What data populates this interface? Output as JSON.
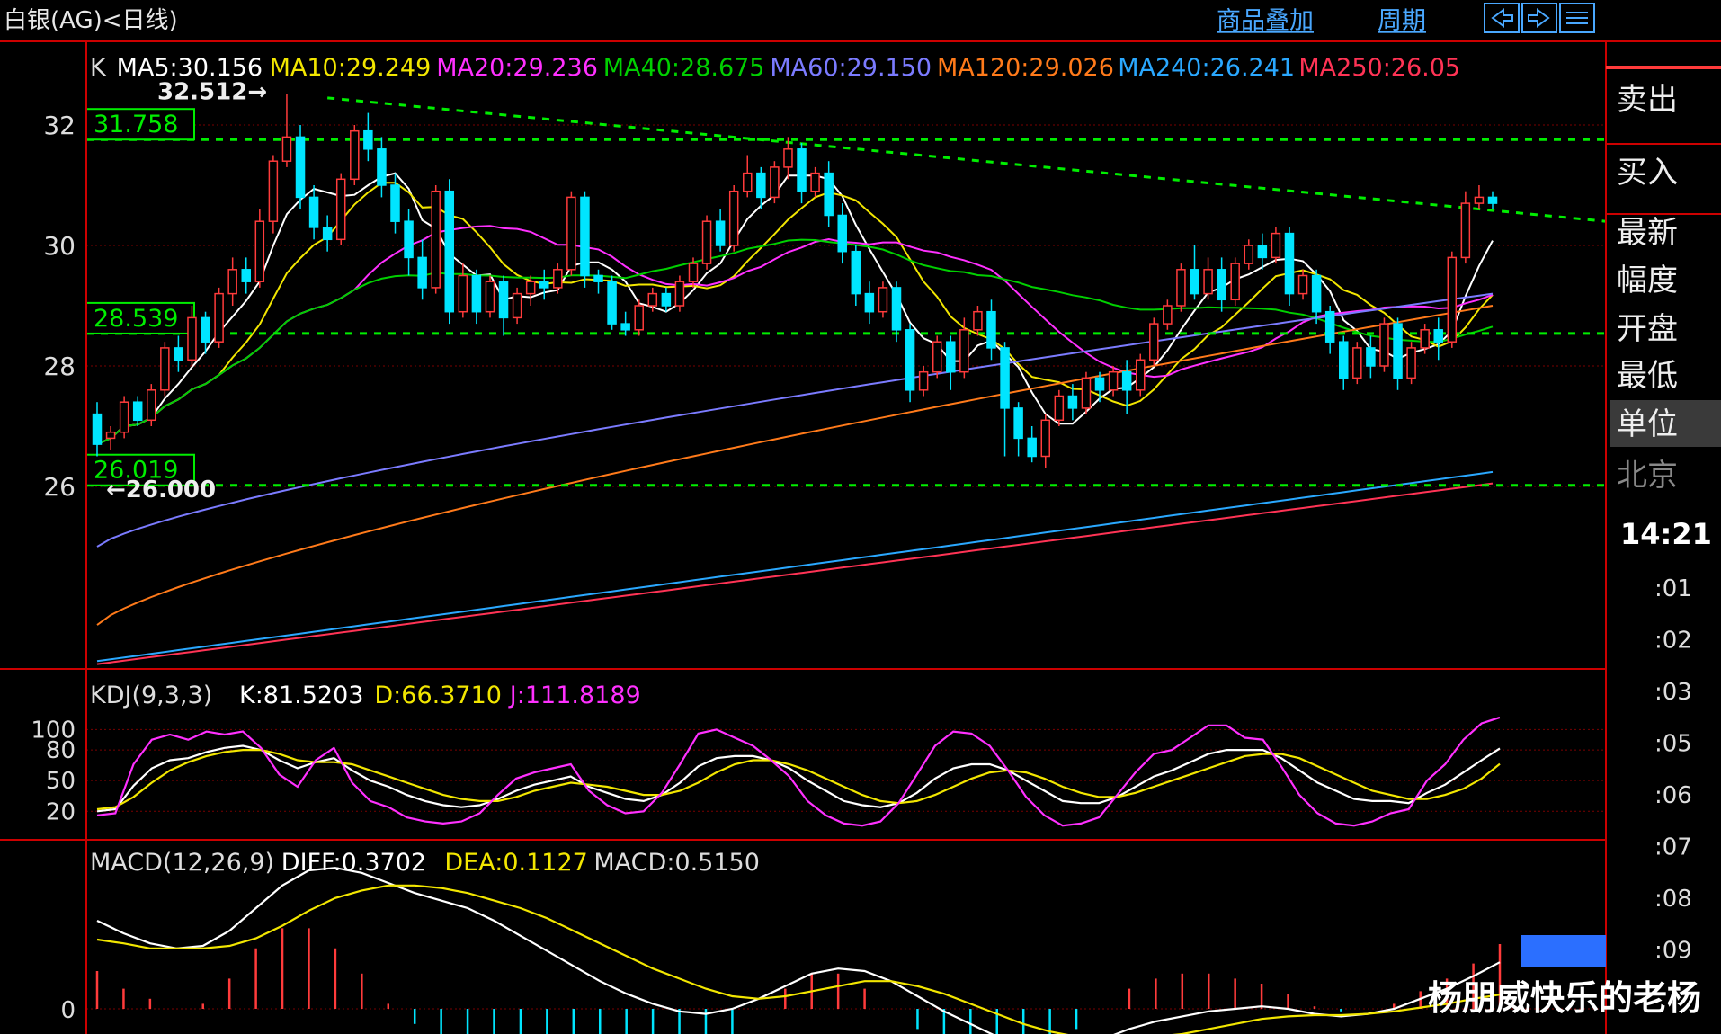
{
  "title": "白银(AG)<日线)",
  "toolbar": {
    "overlay_link": "商品叠加",
    "period_link": "周期"
  },
  "colors": {
    "bg": "#000000",
    "up": "#ff3b3b",
    "down": "#00e5ff",
    "frame": "#cc0000",
    "grid": "#7a0000",
    "green_level": "#00ee00",
    "ma5": "#ffffff",
    "ma10": "#f2e600",
    "ma20": "#ff30ff",
    "ma40": "#00d000",
    "ma60": "#7b7bff",
    "ma120": "#ff7a1a",
    "ma240": "#2aa8ff",
    "ma250": "#ff3355"
  },
  "main_legend": [
    {
      "label": "K",
      "color": "#dddddd"
    },
    {
      "label": "MA5:30.156",
      "color": "#ffffff"
    },
    {
      "label": "MA10:29.249",
      "color": "#f2e600"
    },
    {
      "label": "MA20:29.236",
      "color": "#ff30ff"
    },
    {
      "label": "MA40:28.675",
      "color": "#00d000"
    },
    {
      "label": "MA60:29.150",
      "color": "#7b7bff"
    },
    {
      "label": "MA120:29.026",
      "color": "#ff7a1a"
    },
    {
      "label": "MA240:26.241",
      "color": "#2aa8ff"
    },
    {
      "label": "MA250:26.05",
      "color": "#ff3355"
    }
  ],
  "kdj_legend": [
    {
      "label": "KDJ(9,3,3)",
      "color": "#dddddd"
    },
    {
      "label": "K:81.5203",
      "color": "#ffffff"
    },
    {
      "label": "D:66.3710",
      "color": "#f2e600"
    },
    {
      "label": "J:111.8189",
      "color": "#ff30ff"
    }
  ],
  "macd_legend": [
    {
      "label": "MACD(12,26,9)",
      "color": "#dddddd"
    },
    {
      "label": "DIFF:0.3702",
      "color": "#ffffff"
    },
    {
      "label": "DEA:0.1127",
      "color": "#f2e600"
    },
    {
      "label": "MACD:0.5150",
      "color": "#dddddd"
    }
  ],
  "sidebar": {
    "items": [
      "卖出",
      "买入",
      "最新",
      "幅度",
      "开盘",
      "最低",
      "单位",
      "北京"
    ],
    "time": "14:21",
    "minutes": [
      ":01",
      ":02",
      ":03",
      ":05",
      ":06",
      ":07",
      ":08",
      ":09"
    ]
  },
  "watermark": "杨朋威快乐的老杨",
  "chart_data": [
    {
      "type": "candlestick",
      "name": "main",
      "y_ticks": [
        26,
        28,
        30,
        32
      ],
      "ylim": [
        23.0,
        33.0
      ],
      "level_lines": [
        31.758,
        28.539,
        26.019
      ],
      "annotations": {
        "high_mark": "32.512→",
        "low_mark": "←26.000"
      },
      "candles": [
        [
          27.2,
          26.7,
          27.4,
          26.5
        ],
        [
          26.8,
          26.9,
          27.0,
          26.6
        ],
        [
          26.9,
          27.4,
          27.5,
          26.8
        ],
        [
          27.4,
          27.1,
          27.5,
          27.0
        ],
        [
          27.1,
          27.6,
          27.7,
          27.0
        ],
        [
          27.6,
          28.3,
          28.4,
          27.5
        ],
        [
          28.3,
          28.1,
          28.5,
          27.9
        ],
        [
          28.1,
          28.8,
          29.0,
          28.0
        ],
        [
          28.8,
          28.4,
          28.9,
          28.2
        ],
        [
          28.4,
          29.2,
          29.3,
          28.3
        ],
        [
          29.2,
          29.6,
          29.8,
          29.0
        ],
        [
          29.6,
          29.4,
          29.8,
          29.2
        ],
        [
          29.4,
          30.4,
          30.6,
          29.3
        ],
        [
          30.4,
          31.4,
          31.5,
          30.2
        ],
        [
          31.4,
          31.8,
          32.512,
          31.3
        ],
        [
          31.8,
          30.8,
          32.0,
          30.6
        ],
        [
          30.8,
          30.3,
          31.0,
          30.1
        ],
        [
          30.3,
          30.1,
          30.5,
          29.9
        ],
        [
          30.1,
          31.1,
          31.2,
          30.0
        ],
        [
          31.1,
          31.9,
          32.0,
          31.0
        ],
        [
          31.9,
          31.6,
          32.2,
          31.4
        ],
        [
          31.6,
          31.0,
          31.8,
          30.8
        ],
        [
          31.0,
          30.4,
          31.2,
          30.2
        ],
        [
          30.4,
          29.8,
          30.6,
          29.5
        ],
        [
          29.8,
          29.3,
          30.1,
          29.1
        ],
        [
          29.3,
          30.9,
          31.0,
          29.2
        ],
        [
          30.9,
          28.9,
          31.1,
          28.7
        ],
        [
          28.9,
          29.5,
          29.7,
          28.8
        ],
        [
          29.5,
          28.9,
          29.6,
          28.7
        ],
        [
          28.9,
          29.4,
          29.5,
          28.8
        ],
        [
          29.4,
          28.8,
          29.5,
          28.5
        ],
        [
          28.8,
          29.2,
          29.3,
          28.7
        ],
        [
          29.2,
          29.4,
          29.5,
          29.0
        ],
        [
          29.4,
          29.3,
          29.6,
          29.1
        ],
        [
          29.3,
          29.6,
          29.7,
          29.2
        ],
        [
          29.6,
          30.8,
          30.9,
          29.5
        ],
        [
          30.8,
          29.5,
          30.9,
          29.3
        ],
        [
          29.5,
          29.4,
          29.6,
          29.2
        ],
        [
          29.4,
          28.7,
          29.5,
          28.6
        ],
        [
          28.7,
          28.6,
          28.9,
          28.5
        ],
        [
          28.6,
          29.0,
          29.1,
          28.5
        ],
        [
          29.0,
          29.2,
          29.3,
          28.9
        ],
        [
          29.2,
          29.0,
          29.3,
          28.9
        ],
        [
          29.0,
          29.4,
          29.5,
          28.9
        ],
        [
          29.4,
          29.7,
          29.8,
          29.3
        ],
        [
          29.7,
          30.4,
          30.5,
          29.6
        ],
        [
          30.4,
          30.0,
          30.6,
          29.9
        ],
        [
          30.0,
          30.9,
          31.0,
          29.9
        ],
        [
          30.9,
          31.2,
          31.5,
          30.8
        ],
        [
          31.2,
          30.8,
          31.3,
          30.6
        ],
        [
          30.8,
          31.3,
          31.4,
          30.7
        ],
        [
          31.3,
          31.6,
          31.8,
          31.1
        ],
        [
          31.6,
          30.9,
          31.7,
          30.7
        ],
        [
          30.9,
          31.2,
          31.3,
          30.8
        ],
        [
          31.2,
          30.5,
          31.4,
          30.3
        ],
        [
          30.5,
          29.9,
          30.7,
          29.7
        ],
        [
          29.9,
          29.2,
          30.0,
          29.0
        ],
        [
          29.2,
          28.9,
          29.4,
          28.7
        ],
        [
          28.9,
          29.3,
          29.4,
          28.8
        ],
        [
          29.3,
          28.6,
          29.4,
          28.4
        ],
        [
          28.6,
          27.6,
          28.7,
          27.4
        ],
        [
          27.6,
          27.9,
          28.0,
          27.5
        ],
        [
          27.9,
          28.4,
          28.5,
          27.8
        ],
        [
          28.4,
          27.9,
          28.5,
          27.6
        ],
        [
          27.9,
          28.6,
          28.8,
          27.8
        ],
        [
          28.6,
          28.9,
          29.0,
          28.5
        ],
        [
          28.9,
          28.3,
          29.1,
          28.1
        ],
        [
          28.3,
          27.3,
          28.4,
          26.5
        ],
        [
          27.3,
          26.8,
          27.4,
          26.5
        ],
        [
          26.8,
          26.5,
          27.0,
          26.4
        ],
        [
          26.5,
          27.1,
          27.2,
          26.3
        ],
        [
          27.1,
          27.5,
          27.6,
          27.0
        ],
        [
          27.5,
          27.3,
          27.7,
          27.1
        ],
        [
          27.3,
          27.8,
          27.9,
          27.2
        ],
        [
          27.8,
          27.6,
          27.9,
          27.4
        ],
        [
          27.6,
          27.9,
          28.0,
          27.5
        ],
        [
          27.9,
          27.6,
          28.1,
          27.2
        ],
        [
          27.6,
          28.1,
          28.2,
          27.5
        ],
        [
          28.1,
          28.7,
          28.8,
          28.0
        ],
        [
          28.7,
          29.0,
          29.1,
          28.6
        ],
        [
          29.0,
          29.6,
          29.7,
          28.9
        ],
        [
          29.6,
          29.2,
          30.0,
          29.1
        ],
        [
          29.2,
          29.6,
          29.8,
          29.1
        ],
        [
          29.6,
          29.1,
          29.8,
          28.9
        ],
        [
          29.1,
          29.7,
          29.8,
          29.0
        ],
        [
          29.7,
          30.0,
          30.1,
          29.6
        ],
        [
          30.0,
          29.8,
          30.2,
          29.6
        ],
        [
          29.8,
          30.2,
          30.3,
          29.7
        ],
        [
          30.2,
          29.2,
          30.3,
          29.0
        ],
        [
          29.2,
          29.5,
          29.6,
          29.1
        ],
        [
          29.5,
          28.9,
          29.6,
          28.7
        ],
        [
          28.9,
          28.4,
          29.0,
          28.2
        ],
        [
          28.4,
          27.8,
          28.5,
          27.6
        ],
        [
          27.8,
          28.3,
          28.4,
          27.7
        ],
        [
          28.3,
          28.0,
          28.5,
          27.8
        ],
        [
          28.0,
          28.7,
          28.8,
          27.9
        ],
        [
          28.7,
          27.8,
          28.8,
          27.6
        ],
        [
          27.8,
          28.3,
          28.4,
          27.7
        ],
        [
          28.3,
          28.6,
          28.7,
          28.2
        ],
        [
          28.6,
          28.4,
          28.8,
          28.1
        ],
        [
          28.4,
          29.8,
          29.9,
          28.3
        ],
        [
          29.8,
          30.7,
          30.9,
          29.7
        ],
        [
          30.7,
          30.8,
          31.0,
          30.6
        ],
        [
          30.8,
          30.7,
          30.9,
          30.6
        ]
      ]
    },
    {
      "type": "line",
      "name": "KDJ(9,3,3)",
      "y_ticks": [
        100,
        80,
        50,
        20
      ],
      "ylim": [
        0,
        110
      ],
      "series": [
        {
          "name": "K",
          "values": [
            20,
            22,
            45,
            62,
            70,
            72,
            78,
            82,
            84,
            80,
            70,
            62,
            68,
            72,
            60,
            50,
            44,
            36,
            30,
            26,
            24,
            26,
            32,
            40,
            46,
            50,
            54,
            44,
            38,
            32,
            30,
            36,
            48,
            64,
            72,
            74,
            74,
            70,
            62,
            50,
            40,
            30,
            26,
            24,
            28,
            38,
            52,
            62,
            66,
            66,
            60,
            50,
            40,
            30,
            28,
            28,
            34,
            44,
            54,
            60,
            68,
            76,
            80,
            80,
            80,
            72,
            60,
            48,
            40,
            32,
            30,
            30,
            28,
            38,
            46,
            58,
            70,
            81.52
          ]
        },
        {
          "name": "D",
          "values": [
            22,
            24,
            34,
            48,
            60,
            68,
            74,
            78,
            80,
            80,
            76,
            70,
            68,
            68,
            66,
            60,
            54,
            48,
            42,
            36,
            32,
            30,
            30,
            34,
            40,
            44,
            48,
            46,
            44,
            40,
            36,
            36,
            40,
            48,
            58,
            66,
            70,
            70,
            66,
            60,
            52,
            44,
            36,
            30,
            28,
            30,
            36,
            44,
            52,
            58,
            60,
            58,
            52,
            44,
            38,
            34,
            34,
            38,
            44,
            50,
            56,
            62,
            68,
            74,
            76,
            76,
            72,
            64,
            56,
            48,
            40,
            36,
            32,
            32,
            36,
            42,
            52,
            66.37
          ]
        },
        {
          "name": "J",
          "values": [
            16,
            18,
            66,
            90,
            95,
            90,
            98,
            95,
            98,
            82,
            56,
            44,
            70,
            82,
            48,
            30,
            24,
            14,
            10,
            8,
            10,
            18,
            36,
            52,
            58,
            62,
            66,
            40,
            26,
            18,
            20,
            38,
            66,
            96,
            100,
            92,
            84,
            70,
            54,
            30,
            16,
            8,
            6,
            10,
            28,
            56,
            84,
            98,
            96,
            84,
            60,
            34,
            16,
            6,
            8,
            14,
            36,
            58,
            76,
            80,
            92,
            104,
            104,
            92,
            90,
            64,
            36,
            18,
            8,
            6,
            10,
            18,
            22,
            50,
            66,
            90,
            106,
            111.82
          ]
        }
      ]
    },
    {
      "type": "bar+line",
      "name": "MACD(12,26,9)",
      "y_ticks": [
        0
      ],
      "ylim": [
        -0.1,
        1.2
      ],
      "series": [
        {
          "name": "DIFF",
          "values": [
            0.7,
            0.6,
            0.52,
            0.48,
            0.5,
            0.62,
            0.8,
            0.98,
            1.1,
            1.12,
            1.08,
            1.0,
            0.92,
            0.86,
            0.8,
            0.7,
            0.58,
            0.46,
            0.34,
            0.22,
            0.12,
            0.04,
            -0.02,
            -0.04,
            0.0,
            0.08,
            0.18,
            0.28,
            0.32,
            0.3,
            0.22,
            0.1,
            -0.02,
            -0.12,
            -0.22,
            -0.3,
            -0.34,
            -0.3,
            -0.24,
            -0.16,
            -0.1,
            -0.06,
            -0.02,
            0.0,
            0.02,
            0.0,
            -0.04,
            -0.06,
            -0.04,
            0.0,
            0.08,
            0.16,
            0.26,
            0.37
          ]
        },
        {
          "name": "DEA",
          "values": [
            0.55,
            0.52,
            0.48,
            0.48,
            0.48,
            0.5,
            0.56,
            0.66,
            0.78,
            0.88,
            0.94,
            0.98,
            0.98,
            0.96,
            0.92,
            0.86,
            0.8,
            0.72,
            0.62,
            0.52,
            0.42,
            0.32,
            0.24,
            0.16,
            0.1,
            0.08,
            0.1,
            0.14,
            0.18,
            0.22,
            0.22,
            0.18,
            0.12,
            0.04,
            -0.04,
            -0.12,
            -0.18,
            -0.22,
            -0.24,
            -0.24,
            -0.22,
            -0.2,
            -0.16,
            -0.12,
            -0.08,
            -0.06,
            -0.05,
            -0.05,
            -0.04,
            -0.02,
            0.01,
            0.04,
            0.08,
            0.1127
          ]
        }
      ]
    }
  ]
}
